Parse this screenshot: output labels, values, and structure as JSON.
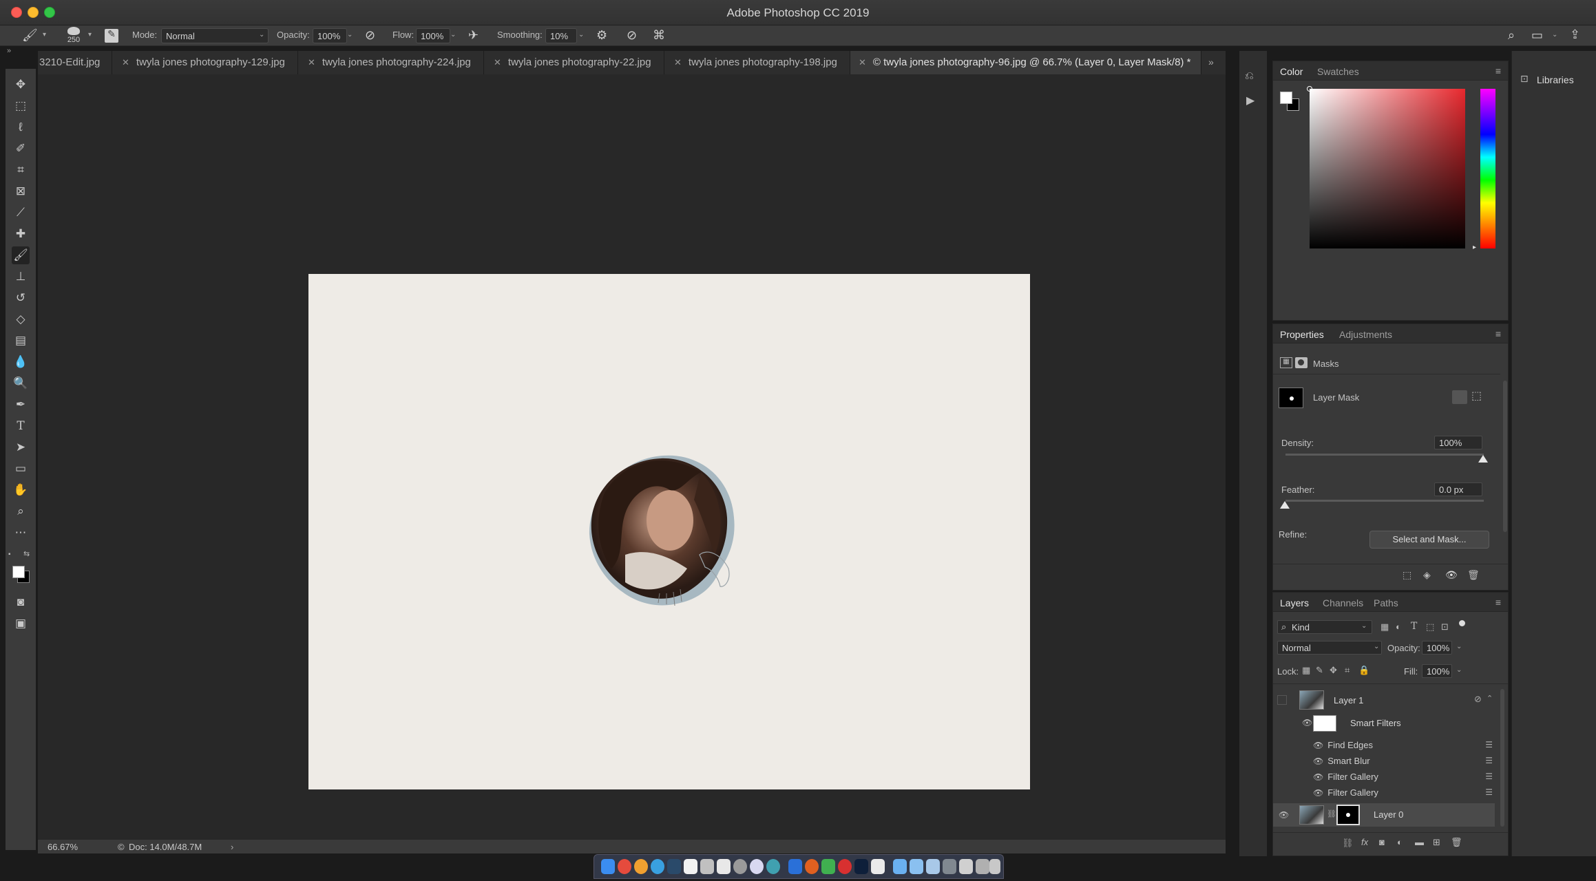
{
  "window": {
    "title": "Adobe Photoshop CC 2019"
  },
  "options_bar": {
    "brush_size": "250",
    "mode_label": "Mode:",
    "mode_value": "Normal",
    "opacity_label": "Opacity:",
    "opacity_value": "100%",
    "flow_label": "Flow:",
    "flow_value": "100%",
    "smoothing_label": "Smoothing:",
    "smoothing_value": "10%"
  },
  "tabs": [
    {
      "label": "3210-Edit.jpg",
      "active": false
    },
    {
      "label": "twyla jones photography-129.jpg",
      "active": false
    },
    {
      "label": "twyla jones photography-224.jpg",
      "active": false
    },
    {
      "label": "twyla jones photography-22.jpg",
      "active": false
    },
    {
      "label": "twyla jones photography-198.jpg",
      "active": false
    },
    {
      "label": "© twyla jones photography-96.jpg @ 66.7% (Layer 0, Layer Mask/8) *",
      "active": true
    }
  ],
  "status_bar": {
    "zoom": "66.67%",
    "doc_size": "Doc: 14.0M/48.7M"
  },
  "color_panel": {
    "tabs": [
      "Color",
      "Swatches"
    ],
    "colors": {
      "hue_base": "#e8282e",
      "foreground": "#ffffff",
      "background": "#000000"
    }
  },
  "properties_panel": {
    "tabs": [
      "Properties",
      "Adjustments"
    ],
    "section_title": "Masks",
    "mask_label": "Layer Mask",
    "density_label": "Density:",
    "density_value": "100%",
    "feather_label": "Feather:",
    "feather_value": "0.0 px",
    "refine_label": "Refine:",
    "select_mask_button": "Select and Mask..."
  },
  "layers_panel": {
    "tabs": [
      "Layers",
      "Channels",
      "Paths"
    ],
    "kind_filter": "Kind",
    "blend_mode": "Normal",
    "opacity_label": "Opacity:",
    "opacity_value": "100%",
    "lock_label": "Lock:",
    "fill_label": "Fill:",
    "fill_value": "100%",
    "layers": [
      {
        "name": "Layer 1",
        "visible": false
      },
      {
        "name": "Layer 0",
        "visible": true
      }
    ],
    "smart_filters_label": "Smart Filters",
    "smart_filters": [
      "Find Edges",
      "Smart Blur",
      "Filter Gallery",
      "Filter Gallery"
    ]
  },
  "libraries": {
    "label": "Libraries"
  }
}
